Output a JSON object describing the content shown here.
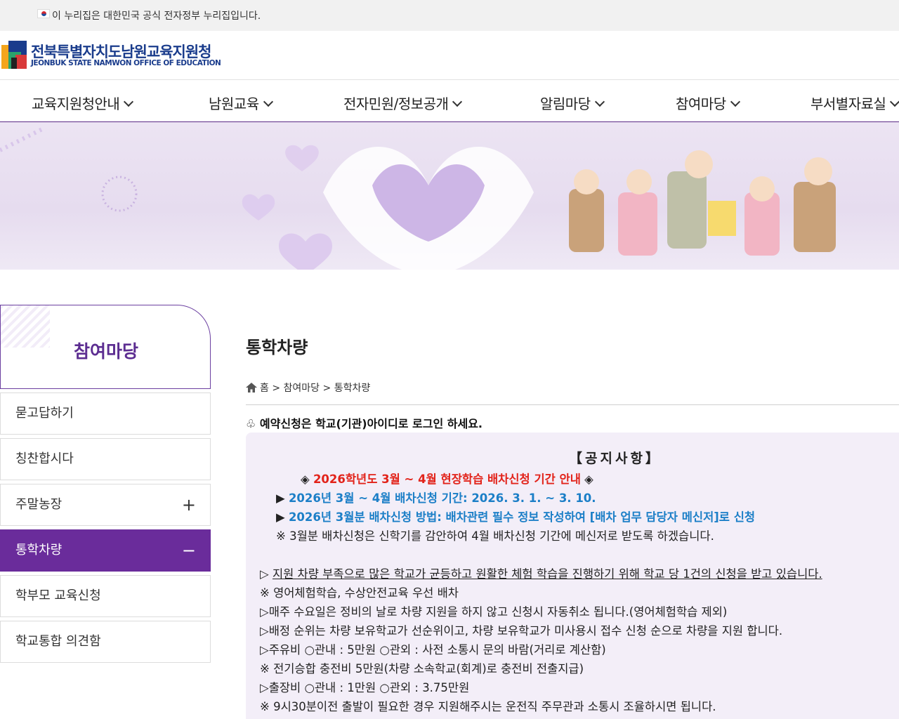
{
  "gov_bar": {
    "text": "이 누리집은 대한민국 공식 전자정부 누리집입니다."
  },
  "logo": {
    "korean": "전북특별자치도남원교육지원청",
    "english": "JEONBUK STATE NAMWON OFFICE OF EDUCATION"
  },
  "gnb": [
    {
      "label": "교육지원청안내"
    },
    {
      "label": "남원교육"
    },
    {
      "label": "전자민원/정보공개"
    },
    {
      "label": "알림마당"
    },
    {
      "label": "참여마당"
    },
    {
      "label": "부서별자료실"
    }
  ],
  "lnb": {
    "title": "참여마당",
    "items": [
      {
        "label": "묻고답하기",
        "toggle": ""
      },
      {
        "label": "칭찬합시다",
        "toggle": ""
      },
      {
        "label": "주말농장",
        "toggle": "+"
      },
      {
        "label": "통학차량",
        "toggle": "−"
      },
      {
        "label": "학부모 교육신청",
        "toggle": ""
      },
      {
        "label": "학교통합 의견함",
        "toggle": ""
      }
    ]
  },
  "page": {
    "title": "통학차량",
    "breadcrumb": [
      "홈",
      "참여마당",
      "통학차량"
    ],
    "breadcrumb_sep": ">",
    "login_notice": "♧ 예약신청은 학교(기관)아이디로 로그인 하세요."
  },
  "notice": {
    "heading": "【공지사항】",
    "l1_prefix": "◈ ",
    "l1_red": "2026학년도 3월 ~ 4월 현장학습 배차신청 기간 안내",
    "l1_suffix": " ◈",
    "l2_prefix": "▶ ",
    "l2_blue": "2026년 3월 ~ 4월 배차신청 기간: 2026. 3. 1. ~ 3. 10.",
    "l3_prefix": "▶ ",
    "l3_blue": "2026년 3월분 배차신청 방법: 배차관련 필수 정보 작성하여 [배차 업무 담당자 메신저]로 신청",
    "l4": "※ 3월분 배차신청은 신학기를 감안하여 4월 배차신청 기간에 메신저로 받도록 하겠습니다.",
    "l5_prefix": "▷ ",
    "l5_u": "지원 차량 부족으로 많은 학교가 균등하고 원활한 체험 학습을 진행하기 위해 학교 당 1건의 신청을 받고 있습니다.",
    "l6": "※ 영어체험학습, 수상안전교육 우선 배차",
    "l7": "▷매주 수요일은 정비의 날로 차량 지원을 하지 않고 신청시 자동취소 됩니다.(영어체험학습 제외)",
    "l8": "▷배정 순위는 차량 보유학교가 선순위이고, 차량 보유학교가 미사용시 접수 신청 순으로 차량을 지원 합니다.",
    "l9": "▷주유비 ○관내 : 5만원 ○관외 : 사전 소통시 문의 바람(거리로 계산함)",
    "l10": "※ 전기승합 충전비 5만원(차량 소속학교(회계)로 충전비 전출지급)",
    "l11": "▷출장비 ○관내 : 1만원 ○관외 : 3.75만원",
    "l12": "※ 9시30분이전 출발이 필요한 경우 지원해주시는 운전직 주무관과 소통시 조율하시면 됩니다."
  },
  "colors": {
    "brand_purple": "#6a2c9b",
    "logo_blue": "#1a3c8c",
    "red": "#e2231a",
    "blue": "#1c7fc7",
    "notice_bg": "#f3eef8"
  }
}
